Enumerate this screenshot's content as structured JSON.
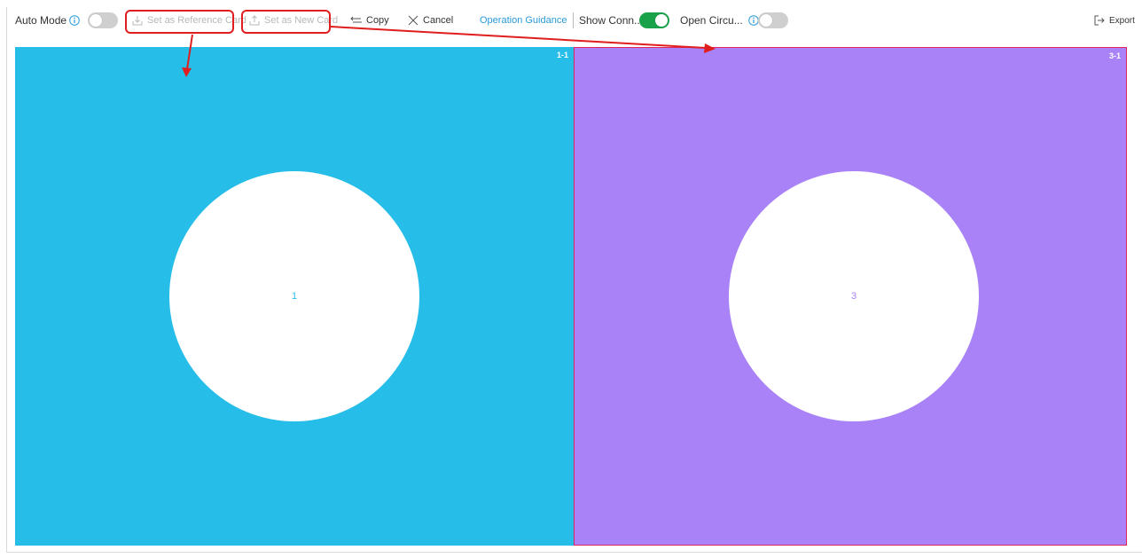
{
  "toolbar": {
    "auto_mode_label": "Auto Mode",
    "auto_mode_on": false,
    "set_reference_label": "Set as Reference Card",
    "set_new_label": "Set as New Card",
    "copy_label": "Copy",
    "cancel_label": "Cancel",
    "guidance_label": "Operation Guidance",
    "show_conn_label": "Show Conn...",
    "show_conn_on": true,
    "open_circ_label": "Open Circu...",
    "open_circ_on": false,
    "export_label": "Export"
  },
  "cards": [
    {
      "tag": "1-1",
      "number": "1",
      "color": "#26bde9"
    },
    {
      "tag": "3-1",
      "number": "3",
      "color": "#a882f6"
    }
  ],
  "colors": {
    "accent_green": "#1aa24a",
    "link_blue": "#2b9ad8",
    "annotation_red": "#e01e1e"
  },
  "icons": [
    "info-icon",
    "download-icon",
    "upload-icon",
    "copy-icon",
    "close-icon",
    "export-icon"
  ]
}
